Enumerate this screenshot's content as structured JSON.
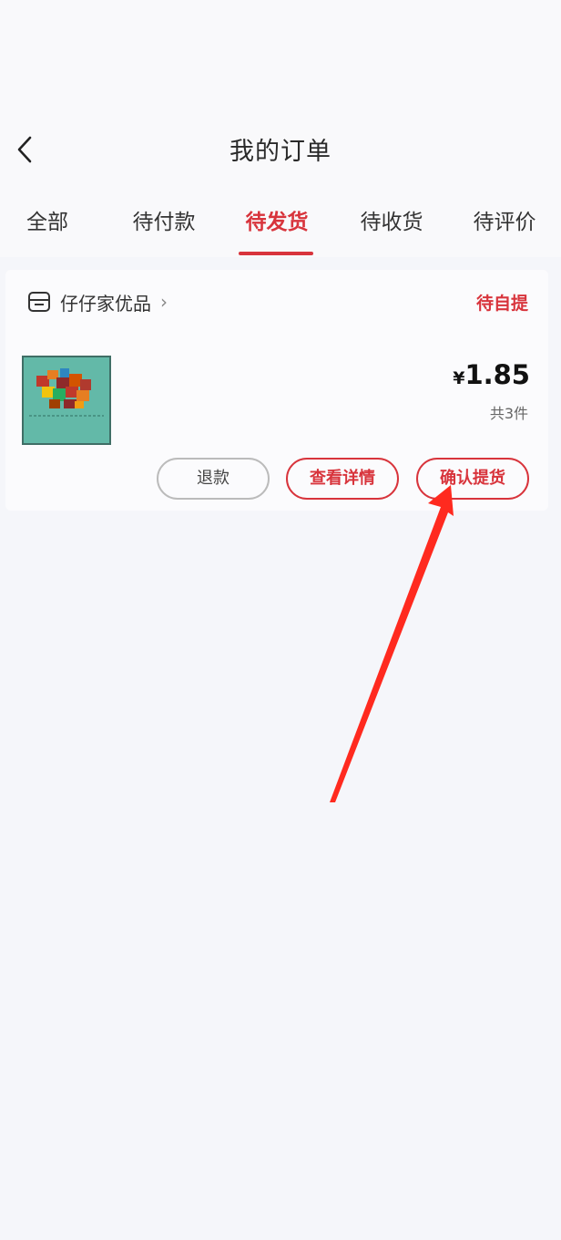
{
  "header": {
    "title": "我的订单",
    "back_icon": "chevron-left-icon"
  },
  "tabs": [
    {
      "label": "全部"
    },
    {
      "label": "待付款"
    },
    {
      "label": "待发货",
      "active": true
    },
    {
      "label": "待收货"
    },
    {
      "label": "待评价"
    }
  ],
  "order": {
    "shop_name": "仔仔家优品",
    "status": "待自提",
    "price_symbol": "¥",
    "price": "1.85",
    "count": "共3件",
    "buttons": {
      "refund": "退款",
      "details": "查看详情",
      "confirm": "确认提货"
    }
  },
  "colors": {
    "accent": "#d8343c",
    "annotation_arrow": "#ff2a1f"
  }
}
